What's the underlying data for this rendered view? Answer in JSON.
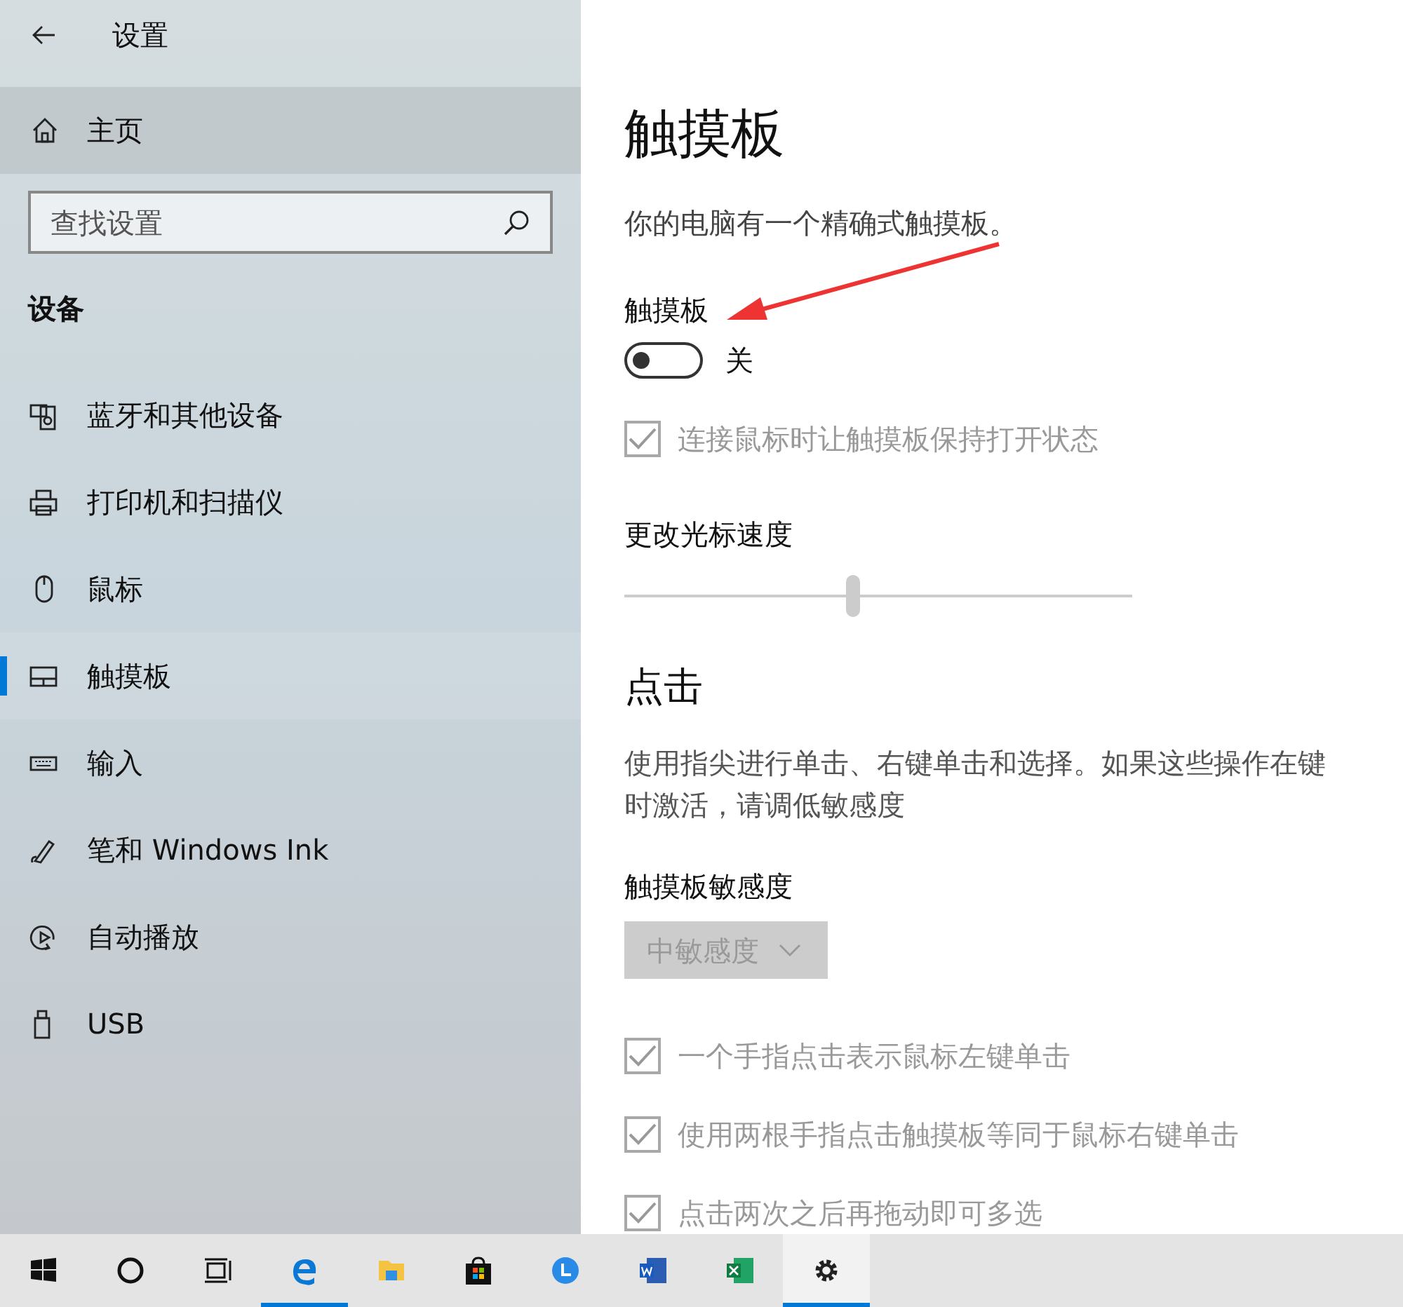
{
  "window": {
    "title": "设置"
  },
  "sidebar": {
    "home": {
      "label": "主页",
      "selected": false
    },
    "search": {
      "placeholder": "查找设置"
    },
    "section": "设备",
    "items": [
      {
        "kind": "bluetooth",
        "label": "蓝牙和其他设备",
        "selected": false
      },
      {
        "kind": "printer",
        "label": "打印机和扫描仪",
        "selected": false
      },
      {
        "kind": "mouse",
        "label": "鼠标",
        "selected": false
      },
      {
        "kind": "touchpad",
        "label": "触摸板",
        "selected": true
      },
      {
        "kind": "keyboard",
        "label": "输入",
        "selected": false
      },
      {
        "kind": "pen",
        "label": "笔和 Windows Ink",
        "selected": false
      },
      {
        "kind": "autoplay",
        "label": "自动播放",
        "selected": false
      },
      {
        "kind": "usb",
        "label": "USB",
        "selected": false
      }
    ]
  },
  "main": {
    "title": "触摸板",
    "description": "你的电脑有一个精确式触摸板。",
    "toggle": {
      "label": "触摸板",
      "on": false,
      "state_text": "关"
    },
    "keep_on": {
      "label": "连接鼠标时让触摸板保持打开状态",
      "checked": true,
      "disabled": true
    },
    "speed": {
      "label": "更改光标速度",
      "level": 0.45,
      "disabled": true
    },
    "tap_section": {
      "title": "点击",
      "lines": [
        "使用指尖进行单击、右键单击和选择。如果这些操作在键",
        "时激活，请调低敏感度"
      ]
    },
    "sensitivity": {
      "label": "触摸板敏感度",
      "value": "中敏感度",
      "disabled": true
    },
    "options": [
      {
        "label": "一个手指点击表示鼠标左键单击",
        "checked": true,
        "disabled": true
      },
      {
        "label": "使用两根手指点击触摸板等同于鼠标右键单击",
        "checked": true,
        "disabled": true
      },
      {
        "label": "点击两次之后再拖动即可多选",
        "checked": true,
        "disabled": true
      }
    ]
  },
  "annotation": {
    "kind": "arrow"
  },
  "taskbar": [
    {
      "kind": "start",
      "running": false,
      "active": false
    },
    {
      "kind": "cortana",
      "running": false,
      "active": false
    },
    {
      "kind": "taskview",
      "running": false,
      "active": false
    },
    {
      "kind": "edge",
      "running": true,
      "active": false
    },
    {
      "kind": "explorer",
      "running": false,
      "active": false
    },
    {
      "kind": "store",
      "running": false,
      "active": false
    },
    {
      "kind": "clock",
      "running": false,
      "active": false
    },
    {
      "kind": "word",
      "running": false,
      "active": false
    },
    {
      "kind": "excel",
      "running": false,
      "active": false
    },
    {
      "kind": "settings",
      "running": true,
      "active": true
    }
  ]
}
